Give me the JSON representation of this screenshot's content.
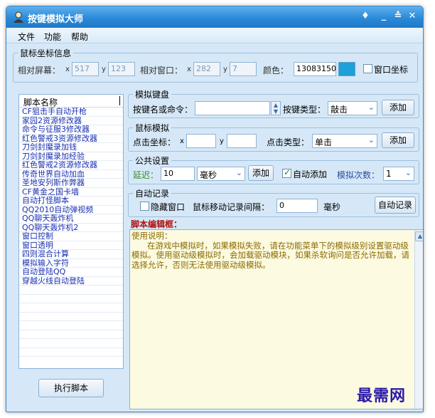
{
  "window": {
    "title": "按键模拟大师"
  },
  "titlebar_buttons": {
    "skin": "♦",
    "minimize": "_",
    "maximize": "≙",
    "close": "✕"
  },
  "menu": [
    "文件",
    "功能",
    "帮助"
  ],
  "mouse_coords": {
    "legend": "鼠标坐标信息",
    "screen_label": "相对屏幕：",
    "x_label": "x",
    "y_label": "y",
    "screen_x": "517",
    "screen_y": "123",
    "window_label": "相对窗口：",
    "window_x": "282",
    "window_y": "7",
    "color_label": "颜色：",
    "color_value": "13083150",
    "swatch_color": "#1ea0d8",
    "window_coord_label": "窗口坐标",
    "window_coord_checked": false
  },
  "script_list": {
    "header": "脚本名称",
    "items": [
      "CF狙击手自动开枪",
      "家园2资源修改器",
      "命令与征服3修改器",
      "红色警戒3资源修改器",
      "刀剑封魔录加钱",
      "刀剑封魔录加经验",
      "红色警戒2资源修改器",
      "传奇世界自动加血",
      "圣地安列斯作弊器",
      "CF黄金之国卡墙",
      "自动打怪脚本",
      "QQ2010自动弹视频",
      "QQ聊天轰炸机",
      "QQ聊天轰炸机2",
      "窗口控制",
      "窗口透明",
      "四则混合计算",
      "模拟输入字符",
      "自动登陆QQ",
      "穿越火线自动登陆"
    ],
    "run_button": "执行脚本"
  },
  "keyboard": {
    "legend": "模拟键盘",
    "key_label": "按键名或命令：",
    "key_value": "",
    "type_label": "按键类型：",
    "type_value": "敲击",
    "add_button": "添加"
  },
  "mouse_sim": {
    "legend": "鼠标模拟",
    "click_label": "点击坐标：",
    "x_label": "x",
    "y_label": "y",
    "x_value": "",
    "y_value": "",
    "type_label": "点击类型：",
    "type_value": "单击",
    "add_button": "添加"
  },
  "common": {
    "legend": "公共设置",
    "delay_label": "延迟：",
    "delay_value": "10",
    "unit_value": "毫秒",
    "add_button": "添加",
    "auto_add_label": "自动添加",
    "auto_add_checked": true,
    "repeat_label": "模拟次数：",
    "repeat_value": "1"
  },
  "auto_record": {
    "legend": "自动记录",
    "hide_window_label": "隐藏窗口",
    "hide_window_checked": false,
    "interval_label": "鼠标移动记录间隔：",
    "interval_value": "0",
    "unit_label": "毫秒",
    "record_button": "自动记录"
  },
  "editor": {
    "title": "脚本编辑框：",
    "text": "使用说明：\n      在游戏中模拟时，如果模拟失败，请在功能菜单下的模拟级别设置驱动级模拟。使用驱动级模拟时，会加载驱动模块，如果杀软询问是否允许加载，请选择允许，否则无法使用驱动级模拟。"
  },
  "watermark": "最需网"
}
